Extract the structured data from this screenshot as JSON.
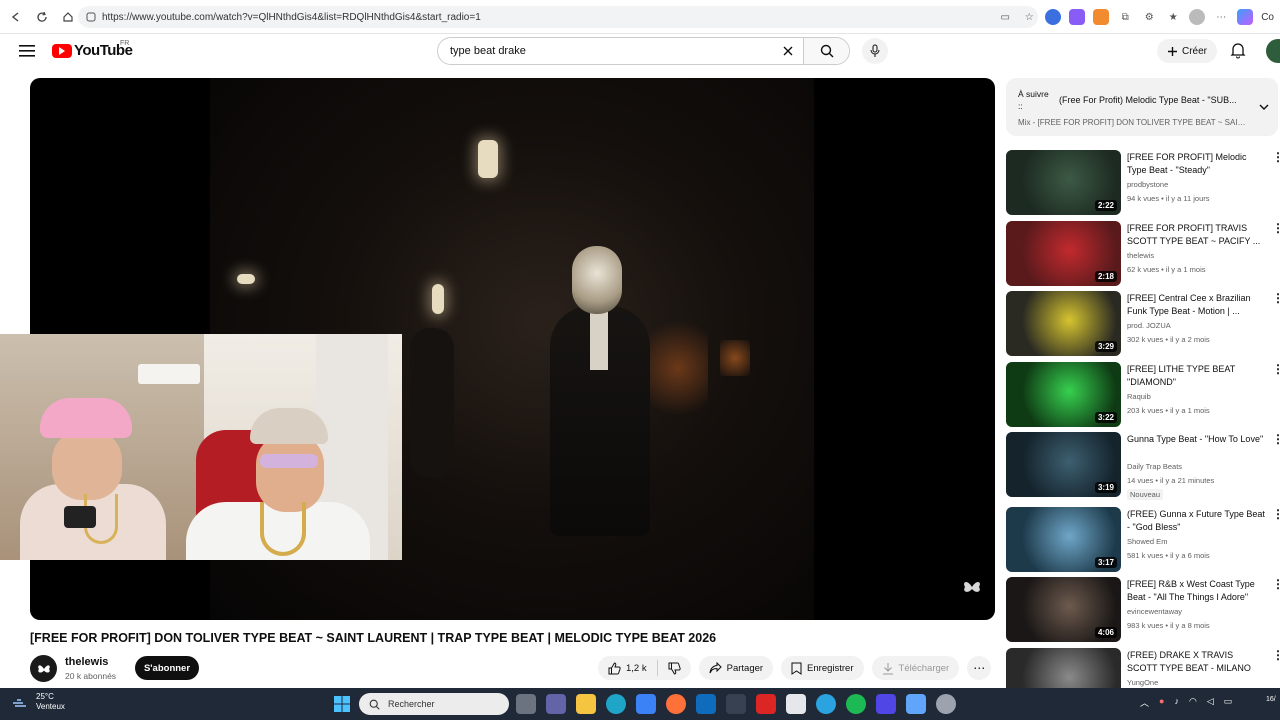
{
  "browser": {
    "url": "https://www.youtube.com/watch?v=QlHNthdGis4&list=RDQlHNthdGis4&start_radio=1",
    "copilot_label": "Co"
  },
  "header": {
    "logo_text": "YouTube",
    "logo_country": "FR",
    "search_value": "type beat drake",
    "create_label": "Créer"
  },
  "video": {
    "title": "[FREE FOR PROFIT] DON TOLIVER TYPE BEAT ~ SAINT LAURENT | TRAP TYPE BEAT | MELODIC TYPE BEAT 2026",
    "channel": "thelewis",
    "subscribers": "20 k abonnés",
    "subscribe_label": "S'abonner",
    "likes": "1,2 k",
    "share_label": "Partager",
    "save_label": "Enregistrer",
    "download_label": "Télécharger"
  },
  "up_next": {
    "label": "À suivre ::",
    "title": "(Free For Profit) Melodic Type Beat - \"SUB...",
    "subtitle": "Mix - [FREE FOR PROFIT] DON TOLIVER TYPE BEAT ~ SAINT ..."
  },
  "recommendations": [
    {
      "title": "[FREE FOR PROFIT] Melodic Type Beat - \"Steady\"",
      "channel": "prodbystone",
      "meta": "94 k vues • il y a 11 jours",
      "duration": "2:22",
      "badge": "",
      "thumb": "#1d2a22",
      "accent": "#3c5a44"
    },
    {
      "title": "[FREE FOR PROFIT] TRAVIS SCOTT TYPE BEAT ~ PACIFY ...",
      "channel": "thelewis",
      "meta": "62 k vues • il y a 1 mois",
      "duration": "2:18",
      "badge": "",
      "thumb": "#5a1a1c",
      "accent": "#c22a2e"
    },
    {
      "title": "[FREE] Central Cee x Brazilian Funk Type Beat - Motion | ...",
      "channel": "prod. JOZUA",
      "meta": "302 k vues • il y a 2 mois",
      "duration": "3:29",
      "badge": "",
      "thumb": "#2a2a22",
      "accent": "#d6c430"
    },
    {
      "title": "[FREE] LITHE TYPE BEAT \"DIAMOND\"",
      "channel": "Raquib",
      "meta": "203 k vues • il y a 1 mois",
      "duration": "3:22",
      "badge": "",
      "thumb": "#0e3a14",
      "accent": "#37d04f"
    },
    {
      "title": "Gunna Type Beat - \"How To Love\"",
      "channel": "Daily Trap Beats",
      "meta": "14 vues • il y a 21 minutes",
      "duration": "3:19",
      "badge": "Nouveau",
      "thumb": "#14232c",
      "accent": "#3d5f70"
    },
    {
      "title": "(FREE) Gunna x Future Type Beat - \"God Bless\"",
      "channel": "Showed Em",
      "meta": "581 k vues • il y a 6 mois",
      "duration": "3:17",
      "badge": "",
      "thumb": "#1d3a4a",
      "accent": "#6fa6c8"
    },
    {
      "title": "[FREE] R&B x West Coast Type Beat - \"All The Things I Adore\"",
      "channel": "evincewentaway",
      "meta": "983 k vues • il y a 8 mois",
      "duration": "4:06",
      "badge": "",
      "thumb": "#1a1716",
      "accent": "#6d5a4e"
    },
    {
      "title": "(FREE) DRAKE X TRAVIS SCOTT TYPE BEAT - MILANO",
      "channel": "YungOne",
      "meta": "",
      "duration": "",
      "badge": "",
      "thumb": "#2a2a2a",
      "accent": "#8a8a8a"
    }
  ],
  "taskbar": {
    "temperature": "25°C",
    "weather": "Venteux",
    "search_placeholder": "Rechercher",
    "clock": "16/"
  }
}
